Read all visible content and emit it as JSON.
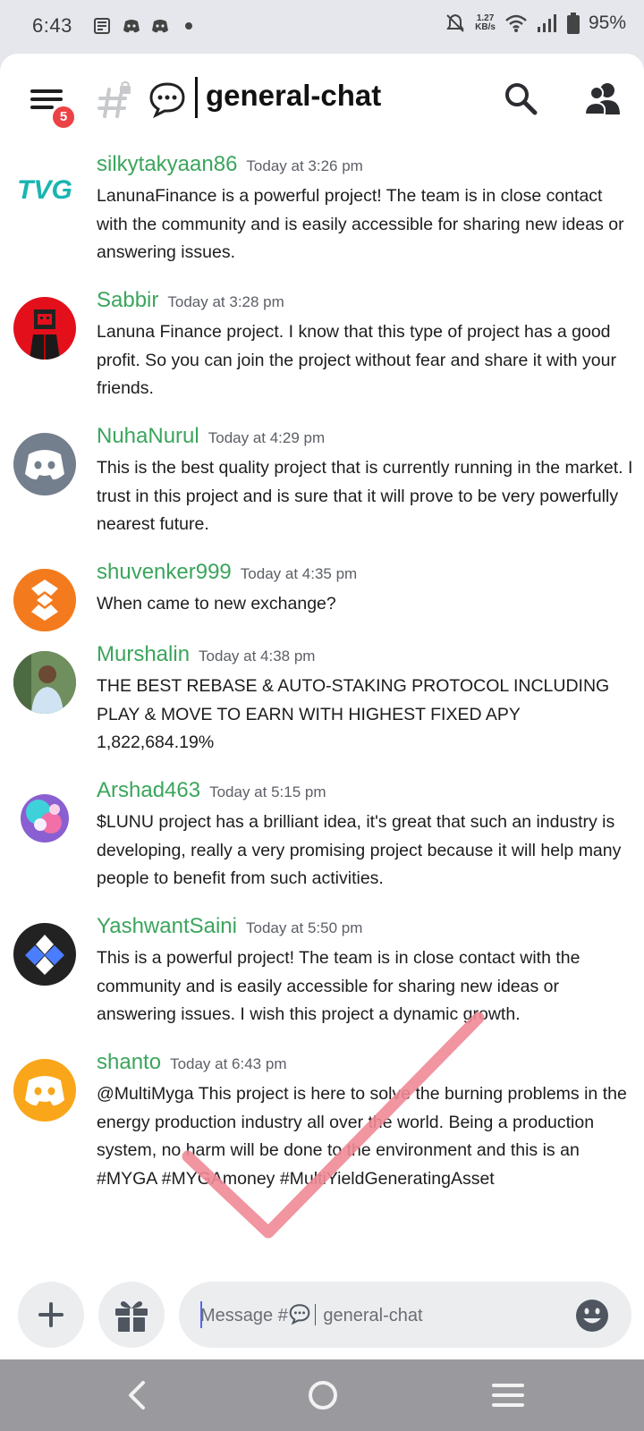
{
  "status_bar": {
    "time": "6:43",
    "speed_value": "1.27",
    "speed_unit": "KB/s",
    "battery": "95%"
  },
  "header": {
    "notification_count": "5",
    "channel_title": "general-chat"
  },
  "messages": [
    {
      "username": "silkytakyaan86",
      "timestamp": "Today at 3:26 pm",
      "text": "LanunaFinance  is a powerful project! The team is in close contact with the community and is easily accessible for sharing new ideas or answering issues.",
      "avatar": "tvg-logo-avatar"
    },
    {
      "username": "Sabbir",
      "timestamp": "Today at 3:28 pm",
      "text": "Lanuna Finance project. I know that this type of project has a good profit. So you can join the project without fear and share it with your friends.",
      "avatar": "red-robot-avatar"
    },
    {
      "username": "NuhaNurul",
      "timestamp": "Today at 4:29 pm",
      "text": "This is the best quality project that is currently running in the market. I trust in this project and is sure that it will prove to be very powerfully nearest future.",
      "avatar": "discord-grey-avatar"
    },
    {
      "username": "shuvenker999",
      "timestamp": "Today at 4:35 pm",
      "text": "When came to new exchange?",
      "avatar": "orange-diamond-avatar"
    },
    {
      "username": "Murshalin",
      "timestamp": "Today at 4:38 pm",
      "text": "THE BEST REBASE & AUTO-STAKING PROTOCOL INCLUDING PLAY & MOVE TO EARN WITH HIGHEST FIXED APY 1,822,684.19%",
      "avatar": "photo-person-avatar"
    },
    {
      "username": "Arshad463",
      "timestamp": "Today at 5:15 pm",
      "text": "$LUNU project has a brilliant idea, it's great that such an industry is developing, really a very promising project because it will help many people to benefit from such activities.",
      "avatar": "colorful-art-avatar"
    },
    {
      "username": "YashwantSaini",
      "timestamp": "Today at 5:50 pm",
      "text": "This is a powerful project! The team is in close contact with the community and is easily accessible for sharing new ideas or answering issues. I wish this project a dynamic growth.",
      "avatar": "blue-diamond-avatar"
    },
    {
      "username": "shanto",
      "timestamp": "Today at 6:43 pm",
      "text": "@MultiMyga This project is here to solve the burning problems in the energy production industry all over the world. Being a production system, no harm will be done to the environment and this is an #MYGA #MYGAmoney #MultiYieldGeneratingAsset",
      "avatar": "discord-yellow-avatar"
    }
  ],
  "composer": {
    "placeholder_prefix": "Message #",
    "placeholder_suffix": "general-chat"
  },
  "colors": {
    "username": "#3ba55c",
    "badge": "#ed4245",
    "overlay_check": "#f08a96"
  }
}
